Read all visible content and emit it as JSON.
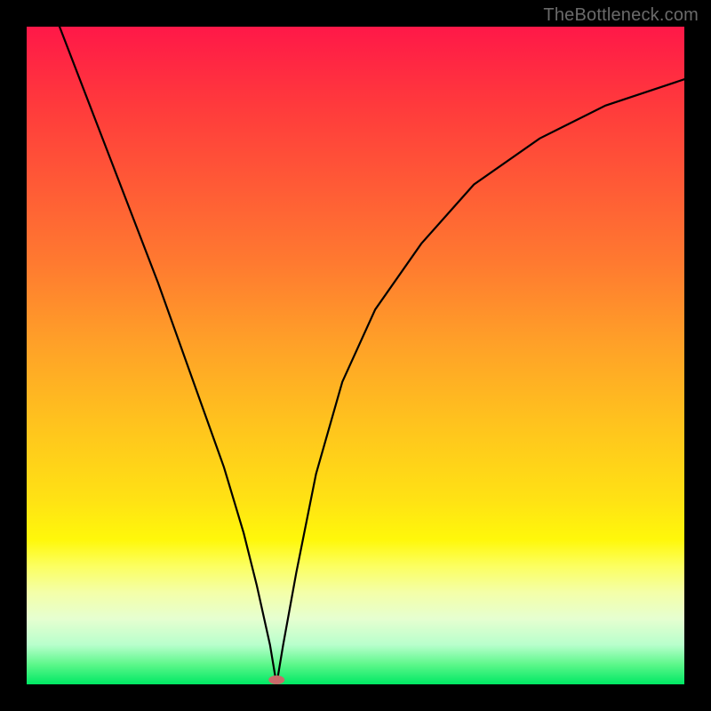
{
  "watermark": "TheBottleneck.com",
  "chart_data": {
    "type": "line",
    "title": "",
    "xlabel": "",
    "ylabel": "",
    "xlim": [
      0,
      100
    ],
    "ylim": [
      0,
      100
    ],
    "minimum_x": 38,
    "minimum_y": 0,
    "marker": {
      "x": 38,
      "y": 0,
      "color": "#c96a6a",
      "rx": 9,
      "ry": 5
    },
    "series": [
      {
        "name": "bottleneck-curve",
        "x": [
          5,
          10,
          15,
          20,
          25,
          30,
          33,
          35,
          37,
          38,
          39,
          41,
          44,
          48,
          53,
          60,
          68,
          78,
          88,
          100
        ],
        "values": [
          100,
          87,
          74,
          61,
          47,
          33,
          23,
          15,
          6,
          0,
          6,
          17,
          32,
          46,
          57,
          67,
          76,
          83,
          88,
          92
        ]
      }
    ],
    "background_gradient": {
      "top": "#ff1848",
      "mid": "#ffe214",
      "bottom": "#00e864"
    }
  }
}
